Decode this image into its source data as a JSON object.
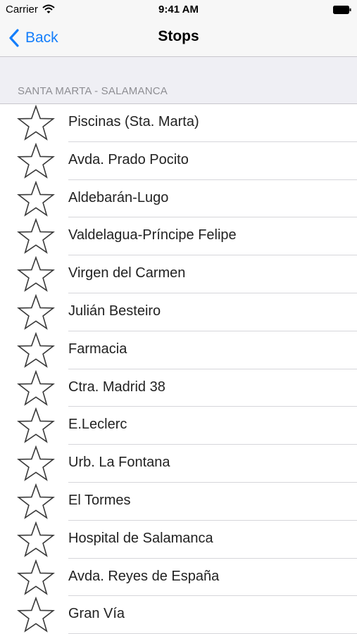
{
  "status_bar": {
    "carrier": "Carrier",
    "time": "9:41 AM",
    "icons": [
      "wifi-icon",
      "battery-icon"
    ]
  },
  "nav": {
    "back_label": "Back",
    "title": "Stops",
    "accent": "#147efb"
  },
  "section": {
    "header": "SANTA MARTA - SALAMANCA"
  },
  "stops": [
    {
      "name": "Piscinas (Sta. Marta)",
      "icon": "star-outline-icon"
    },
    {
      "name": "Avda. Prado Pocito",
      "icon": "star-outline-icon"
    },
    {
      "name": "Aldebarán-Lugo",
      "icon": "star-outline-icon"
    },
    {
      "name": "Valdelagua-Príncipe Felipe",
      "icon": "star-outline-icon"
    },
    {
      "name": "Virgen del Carmen",
      "icon": "star-outline-icon"
    },
    {
      "name": "Julián Besteiro",
      "icon": "star-outline-icon"
    },
    {
      "name": "Farmacia",
      "icon": "star-outline-icon"
    },
    {
      "name": "Ctra. Madrid 38",
      "icon": "star-outline-icon"
    },
    {
      "name": "E.Leclerc",
      "icon": "star-outline-icon"
    },
    {
      "name": "Urb. La Fontana",
      "icon": "star-outline-icon"
    },
    {
      "name": "El Tormes",
      "icon": "star-outline-icon"
    },
    {
      "name": "Hospital de Salamanca",
      "icon": "star-outline-icon"
    },
    {
      "name": "Avda. Reyes de España",
      "icon": "star-outline-icon"
    },
    {
      "name": "Gran Vía",
      "icon": "star-outline-icon"
    }
  ]
}
